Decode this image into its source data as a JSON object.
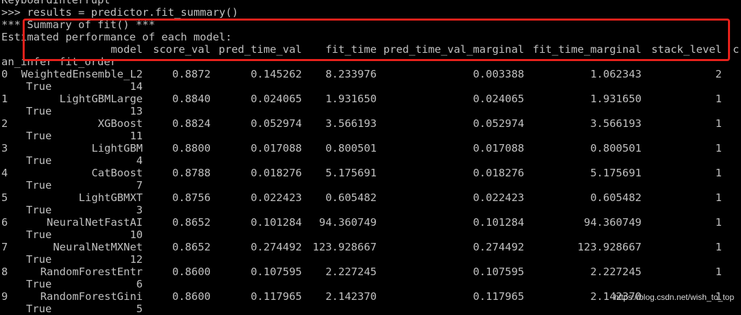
{
  "console": {
    "interrupt_text": "KeyboardInterrupt",
    "prompt_text": ">>> results = predictor.fit_summary()",
    "summary_header": "*** Summary of fit() ***",
    "estimated_text": "Estimated performance of each model:",
    "table": {
      "columns": [
        "model",
        "score_val",
        "pred_time_val",
        "fit_time",
        "pred_time_val_marginal",
        "fit_time_marginal",
        "stack_level",
        "c"
      ],
      "wrapped_columns": [
        "an_infer",
        "fit_order"
      ],
      "rows": [
        {
          "idx": "0",
          "model": "WeightedEnsemble_L2",
          "score_val": "0.8872",
          "pred_time_val": "0.145262",
          "fit_time": "8.233976",
          "pred_time_val_marginal": "0.003388",
          "fit_time_marginal": "1.062343",
          "stack_level": "2",
          "can_infer": "True",
          "fit_order": "14"
        },
        {
          "idx": "1",
          "model": "LightGBMLarge",
          "score_val": "0.8840",
          "pred_time_val": "0.024065",
          "fit_time": "1.931650",
          "pred_time_val_marginal": "0.024065",
          "fit_time_marginal": "1.931650",
          "stack_level": "1",
          "can_infer": "True",
          "fit_order": "13"
        },
        {
          "idx": "2",
          "model": "XGBoost",
          "score_val": "0.8824",
          "pred_time_val": "0.052974",
          "fit_time": "3.566193",
          "pred_time_val_marginal": "0.052974",
          "fit_time_marginal": "3.566193",
          "stack_level": "1",
          "can_infer": "True",
          "fit_order": "11"
        },
        {
          "idx": "3",
          "model": "LightGBM",
          "score_val": "0.8800",
          "pred_time_val": "0.017088",
          "fit_time": "0.800501",
          "pred_time_val_marginal": "0.017088",
          "fit_time_marginal": "0.800501",
          "stack_level": "1",
          "can_infer": "True",
          "fit_order": "4"
        },
        {
          "idx": "4",
          "model": "CatBoost",
          "score_val": "0.8788",
          "pred_time_val": "0.018276",
          "fit_time": "5.175691",
          "pred_time_val_marginal": "0.018276",
          "fit_time_marginal": "5.175691",
          "stack_level": "1",
          "can_infer": "True",
          "fit_order": "7"
        },
        {
          "idx": "5",
          "model": "LightGBMXT",
          "score_val": "0.8756",
          "pred_time_val": "0.022423",
          "fit_time": "0.605482",
          "pred_time_val_marginal": "0.022423",
          "fit_time_marginal": "0.605482",
          "stack_level": "1",
          "can_infer": "True",
          "fit_order": "3"
        },
        {
          "idx": "6",
          "model": "NeuralNetFastAI",
          "score_val": "0.8652",
          "pred_time_val": "0.101284",
          "fit_time": "94.360749",
          "pred_time_val_marginal": "0.101284",
          "fit_time_marginal": "94.360749",
          "stack_level": "1",
          "can_infer": "True",
          "fit_order": "10"
        },
        {
          "idx": "7",
          "model": "NeuralNetMXNet",
          "score_val": "0.8652",
          "pred_time_val": "0.274492",
          "fit_time": "123.928667",
          "pred_time_val_marginal": "0.274492",
          "fit_time_marginal": "123.928667",
          "stack_level": "1",
          "can_infer": "True",
          "fit_order": "12"
        },
        {
          "idx": "8",
          "model": "RandomForestEntr",
          "score_val": "0.8600",
          "pred_time_val": "0.107595",
          "fit_time": "2.227245",
          "pred_time_val_marginal": "0.107595",
          "fit_time_marginal": "2.227245",
          "stack_level": "1",
          "can_infer": "True",
          "fit_order": "6"
        },
        {
          "idx": "9",
          "model": "RandomForestGini",
          "score_val": "0.8600",
          "pred_time_val": "0.117965",
          "fit_time": "2.142370",
          "pred_time_val_marginal": "0.117965",
          "fit_time_marginal": "2.142370",
          "stack_level": "1",
          "can_infer": "True",
          "fit_order": "5"
        }
      ]
    }
  },
  "watermark": "https://blog.csdn.net/wish_to_top",
  "colors": {
    "background": "#000000",
    "text": "#c0c0c0",
    "highlight_box": "#e8211b"
  }
}
